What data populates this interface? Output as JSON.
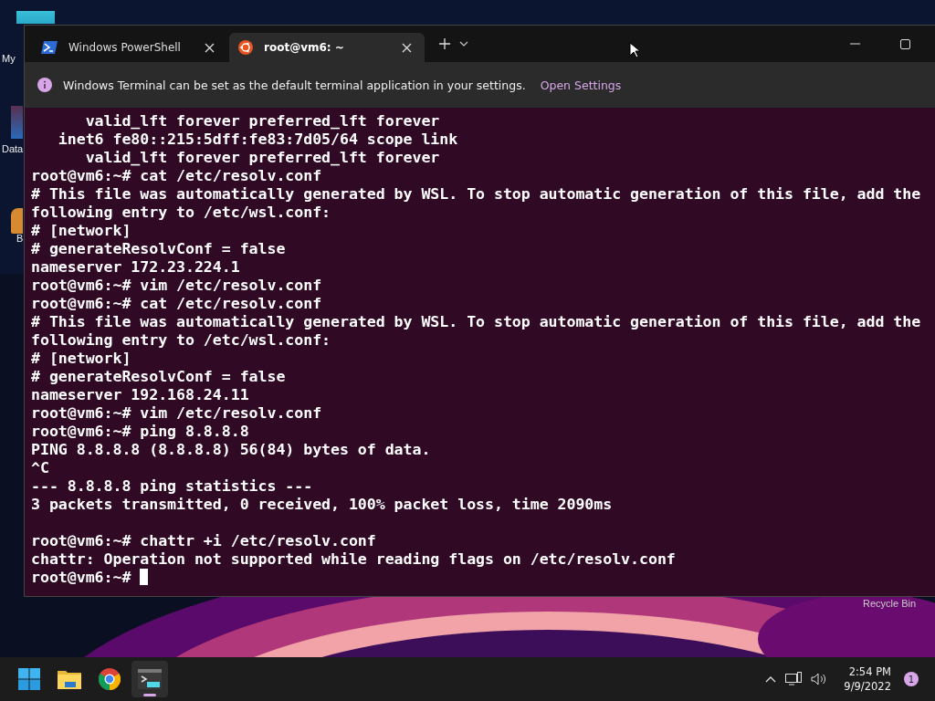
{
  "desktop": {
    "icons": [
      {
        "label": "My"
      },
      {
        "label": "Data"
      },
      {
        "label": "B"
      },
      {
        "label": "Recycle Bin"
      }
    ]
  },
  "window": {
    "tabs": [
      {
        "title": "Windows PowerShell",
        "kind": "powershell",
        "selected": false
      },
      {
        "title": "root@vm6: ~",
        "kind": "ubuntu",
        "selected": true
      }
    ],
    "infobar": {
      "message": "Windows Terminal can be set as the default terminal application in your settings.",
      "link": "Open Settings"
    },
    "terminal": {
      "lines": [
        "      valid_lft forever preferred_lft forever",
        "   inet6 fe80::215:5dff:fe83:7d05/64 scope link",
        "      valid_lft forever preferred_lft forever",
        "root@vm6:~# cat /etc/resolv.conf",
        "# This file was automatically generated by WSL. To stop automatic generation of this file, add the",
        "following entry to /etc/wsl.conf:",
        "# [network]",
        "# generateResolvConf = false",
        "nameserver 172.23.224.1",
        "root@vm6:~# vim /etc/resolv.conf",
        "root@vm6:~# cat /etc/resolv.conf",
        "# This file was automatically generated by WSL. To stop automatic generation of this file, add the",
        "following entry to /etc/wsl.conf:",
        "# [network]",
        "# generateResolvConf = false",
        "nameserver 192.168.24.11",
        "root@vm6:~# vim /etc/resolv.conf",
        "root@vm6:~# ping 8.8.8.8",
        "PING 8.8.8.8 (8.8.8.8) 56(84) bytes of data.",
        "^C",
        "--- 8.8.8.8 ping statistics ---",
        "3 packets transmitted, 0 received, 100% packet loss, time 2090ms"
      ],
      "after_blank": [
        "root@vm6:~# chattr +i /etc/resolv.conf",
        "chattr: Operation not supported while reading flags on /etc/resolv.conf"
      ],
      "prompt": "root@vm6:~#"
    }
  },
  "taskbar": {
    "apps": [
      {
        "kind": "start",
        "selected": false
      },
      {
        "kind": "folder",
        "selected": false
      },
      {
        "kind": "browser",
        "selected": false
      },
      {
        "kind": "terminal",
        "selected": true
      }
    ],
    "time": "2:54 PM",
    "date": "9/9/2022",
    "notifications": "1"
  }
}
